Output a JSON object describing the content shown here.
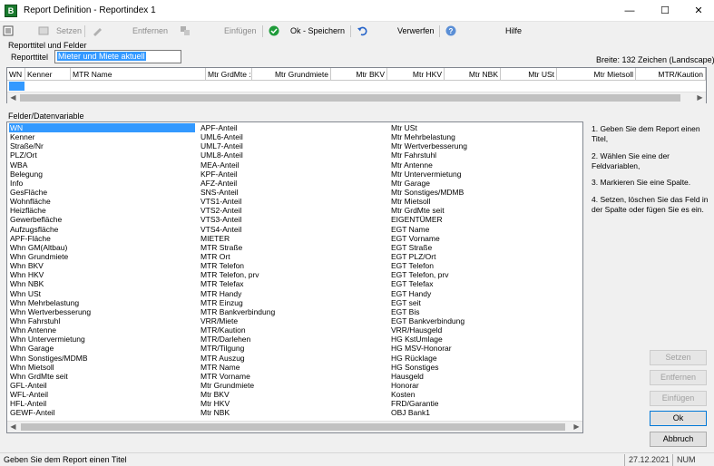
{
  "window": {
    "title": "Report Definition - Reportindex 1",
    "app_icon_glyph": "B",
    "minimize_glyph": "—",
    "maximize_glyph": "☐",
    "close_glyph": "✕"
  },
  "toolbar": {
    "setzen": "Setzen",
    "entfernen": "Entfernen",
    "einfuegen": "Einfügen",
    "ok_speichern": "Ok - Speichern",
    "verwerfen": "Verwerfen",
    "hilfe": "Hilfe"
  },
  "report": {
    "group_label": "Reporttitel und Felder",
    "title_label": "Reporttitel",
    "title_value": "Mieter und Miete aktuell",
    "width_info": "Breite: 132 Zeichen (Landscape)"
  },
  "grid": {
    "columns": [
      "WN",
      "Kenner",
      "MTR Name",
      "Mtr GrdMte :",
      "Mtr Grundmiete",
      "Mtr BKV",
      "Mtr HKV",
      "Mtr NBK",
      "Mtr USt",
      "Mtr Mietsoll",
      "MTR/Kaution"
    ]
  },
  "fields": {
    "label": "Felder/Datenvariable",
    "col1": [
      "WN",
      "Kenner",
      "Straße/Nr",
      "PLZ/Ort",
      "WBA",
      "Belegung",
      "Info",
      "GesFläche",
      "Wohnfläche",
      "Heizfläche",
      "Gewerbefläche",
      "Aufzugsfläche",
      "APF-Fläche",
      "Whn GM(Altbau)",
      "Whn Grundmiete",
      "Whn BKV",
      "Whn HKV",
      "Whn NBK",
      "Whn USt",
      "Whn Mehrbelastung",
      "Whn Wertverbesserung",
      "Whn Fahrstuhl",
      "Whn Antenne",
      "Whn Untervermietung",
      "Whn Garage",
      "Whn Sonstiges/MDMB",
      "Whn Mietsoll",
      "Whn GrdMte seit",
      "GFL-Anteil",
      "WFL-Anteil",
      "HFL-Anteil",
      "GEWF-Anteil"
    ],
    "col2": [
      "APF-Anteil",
      "UML6-Anteil",
      "UML7-Anteil",
      "UML8-Anteil",
      "MEA-Anteil",
      "KPF-Anteil",
      "AFZ-Anteil",
      "SNS-Anteil",
      "VTS1-Anteil",
      "VTS2-Anteil",
      "VTS3-Anteil",
      "VTS4-Anteil",
      "MIETER",
      "MTR Straße",
      "MTR Ort",
      "MTR Telefon",
      "MTR Telefon, prv",
      "MTR Telefax",
      "MTR Handy",
      "MTR Einzug",
      "MTR Bankverbindung",
      "VRR/Miete",
      "MTR/Kaution",
      "MTR/Darlehen",
      "MTR/Tilgung",
      "MTR Auszug",
      "MTR Name",
      "MTR Vorname",
      "Mtr Grundmiete",
      "Mtr BKV",
      "Mtr HKV",
      "Mtr NBK"
    ],
    "col3": [
      "Mtr USt",
      "Mtr Mehrbelastung",
      "Mtr Wertverbesserung",
      "Mtr Fahrstuhl",
      "Mtr Antenne",
      "Mtr Untervermietung",
      "Mtr Garage",
      "Mtr Sonstiges/MDMB",
      "Mtr Mietsoll",
      "Mtr GrdMte seit",
      "EIGENTÜMER",
      "EGT Name",
      "EGT Vorname",
      "EGT Straße",
      "EGT PLZ/Ort",
      "EGT Telefon",
      "EGT Telefon, prv",
      "EGT Telefax",
      "EGT Handy",
      "EGT seit",
      "EGT Bis",
      "EGT Bankverbindung",
      "VRR/Hausgeld",
      "HG KstUmlage",
      "HG MSV-Honorar",
      "HG Rücklage",
      "HG Sonstiges",
      "Hausgeld",
      "Honorar",
      "Kosten",
      "FRD/Garantie",
      "OBJ Bank1"
    ]
  },
  "instructions": [
    "1. Geben Sie dem Report einen Titel,",
    "2. Wählen Sie eine der Feldvariablen,",
    "3. Markieren Sie eine Spalte.",
    "4. Setzen, löschen Sie das Feld in der Spalte oder fügen Sie es ein."
  ],
  "buttons": {
    "setzen": "Setzen",
    "entfernen": "Entfernen",
    "einfuegen": "Einfügen",
    "ok": "Ok",
    "abbruch": "Abbruch"
  },
  "status": {
    "message": "Geben Sie dem Report einen Titel",
    "date": "27.12.2021",
    "num": "NUM"
  },
  "colors": {
    "selection": "#3399ff",
    "ok_green": "#1f9b3a",
    "undo_blue": "#2563c9"
  },
  "icons": [
    "app-icon",
    "setzen-icon",
    "entfernen-icon",
    "einfuegen-icon",
    "ok-check-icon",
    "undo-icon",
    "help-icon"
  ]
}
